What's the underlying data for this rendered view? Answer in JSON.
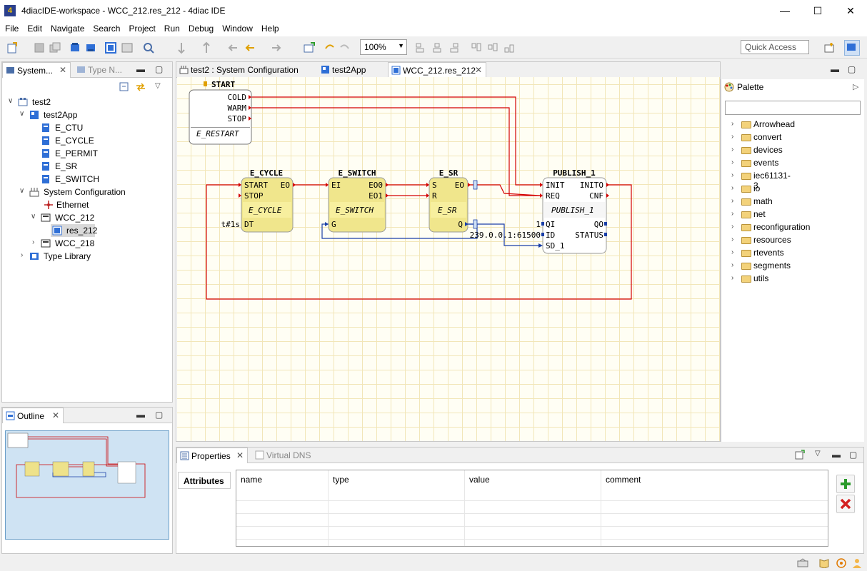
{
  "window": {
    "title": "4diacIDE-workspace - WCC_212.res_212 - 4diac IDE",
    "app_icon": "4diac-logo-icon"
  },
  "menu": [
    "File",
    "Edit",
    "Navigate",
    "Search",
    "Project",
    "Run",
    "Debug",
    "Window",
    "Help"
  ],
  "toolbar": {
    "zoom_value": "100%",
    "quick_access": "Quick Access"
  },
  "left_panel": {
    "tabs": [
      {
        "label": "System..."
      },
      {
        "label": "Type N..."
      }
    ],
    "tree": [
      {
        "label": "test2",
        "icon": "system-icon"
      },
      {
        "label": "test2App",
        "icon": "application-icon"
      },
      {
        "label": "E_CTU",
        "icon": "function-block-icon"
      },
      {
        "label": "E_CYCLE",
        "icon": "function-block-icon"
      },
      {
        "label": "E_PERMIT",
        "icon": "function-block-icon"
      },
      {
        "label": "E_SR",
        "icon": "function-block-icon"
      },
      {
        "label": "E_SWITCH",
        "icon": "function-block-icon"
      },
      {
        "label": "System Configuration",
        "icon": "system-configuration-icon"
      },
      {
        "label": "Ethernet",
        "icon": "ethernet-icon"
      },
      {
        "label": "WCC_212",
        "icon": "device-icon"
      },
      {
        "label": "res_212",
        "icon": "resource-icon"
      },
      {
        "label": "WCC_218",
        "icon": "device-icon"
      },
      {
        "label": "Type Library",
        "icon": "type-library-icon"
      }
    ]
  },
  "outline": {
    "tab": "Outline"
  },
  "editor": {
    "tabs": [
      {
        "label": "test2 : System Configuration"
      },
      {
        "label": "test2App"
      },
      {
        "label": "WCC_212.res_212"
      }
    ],
    "blocks": {
      "start": {
        "title": "START",
        "type": "E_RESTART",
        "outputs": [
          "COLD",
          "WARM",
          "STOP"
        ]
      },
      "cycle": {
        "title": "E_CYCLE",
        "type": "E_CYCLE",
        "in": [
          "START",
          "STOP"
        ],
        "out": [
          "EO"
        ],
        "data_in": "DT",
        "param": "t#1s"
      },
      "switch": {
        "title": "E_SWITCH",
        "type": "E_SWITCH",
        "in": [
          "EI"
        ],
        "out": [
          "EO0",
          "EO1"
        ],
        "data_in": "G"
      },
      "sr": {
        "title": "E_SR",
        "type": "E_SR",
        "in": [
          "S",
          "R"
        ],
        "out": [
          "EO"
        ],
        "data_out": "Q"
      },
      "publish": {
        "title": "PUBLISH_1",
        "type": "PUBLISH_1",
        "in": [
          "INIT",
          "REQ"
        ],
        "out": [
          "INITO",
          "CNF"
        ],
        "data_in": [
          "QI",
          "ID",
          "SD_1"
        ],
        "data_out": [
          "QO",
          "STATUS"
        ],
        "param_qi": "1",
        "param_id": "239.0.0.1:61500"
      }
    }
  },
  "palette": {
    "title": "Palette",
    "items": [
      "Arrowhead",
      "convert",
      "devices",
      "events",
      "iec61131-3",
      "io",
      "math",
      "net",
      "reconfiguration",
      "resources",
      "rtevents",
      "segments",
      "utils"
    ]
  },
  "properties": {
    "tabs": [
      {
        "label": "Properties"
      },
      {
        "label": "Virtual DNS"
      }
    ],
    "section": "Attributes",
    "columns": [
      "name",
      "type",
      "value",
      "comment"
    ]
  }
}
